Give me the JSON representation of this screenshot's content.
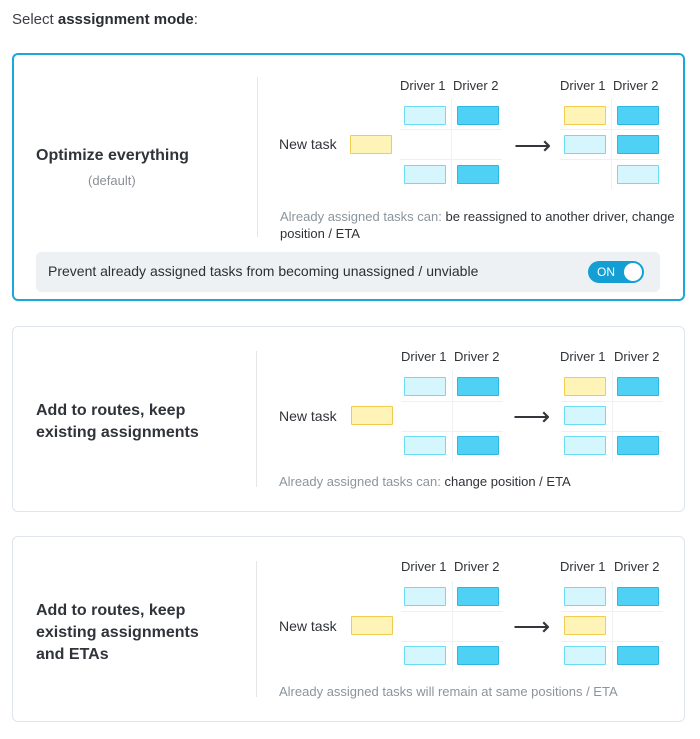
{
  "heading": {
    "prefix": "Select ",
    "bold": "asssignment mode",
    "suffix": ":"
  },
  "columns": {
    "driver1": "Driver 1",
    "driver2": "Driver 2",
    "new_task": "New task"
  },
  "colors": {
    "selected_border": "#1aa7d9",
    "new_task_box": "#fff4b8",
    "light_task_box": "#d6f6fd",
    "dark_task_box": "#4fd0f5",
    "toggle_on": "#139fd4"
  },
  "modes": [
    {
      "title": "Optimize everything",
      "subtitle": "(default)",
      "selected": true,
      "note_muted": "Already assigned tasks can:",
      "note_text": " be reassigned to another driver, change position / ETA",
      "option": {
        "label": "Prevent already assigned tasks from becoming unassigned / unviable",
        "toggle": "ON"
      }
    },
    {
      "title": "Add to routes, keep existing assignments",
      "subtitle": "",
      "selected": false,
      "note_muted": "Already assigned tasks can:",
      "note_text": " change position / ETA"
    },
    {
      "title": "Add to routes, keep existing assignments and ETAs",
      "subtitle": "",
      "selected": false,
      "note_muted": "Already assigned tasks will remain at same positions / ETA",
      "note_text": ""
    }
  ]
}
